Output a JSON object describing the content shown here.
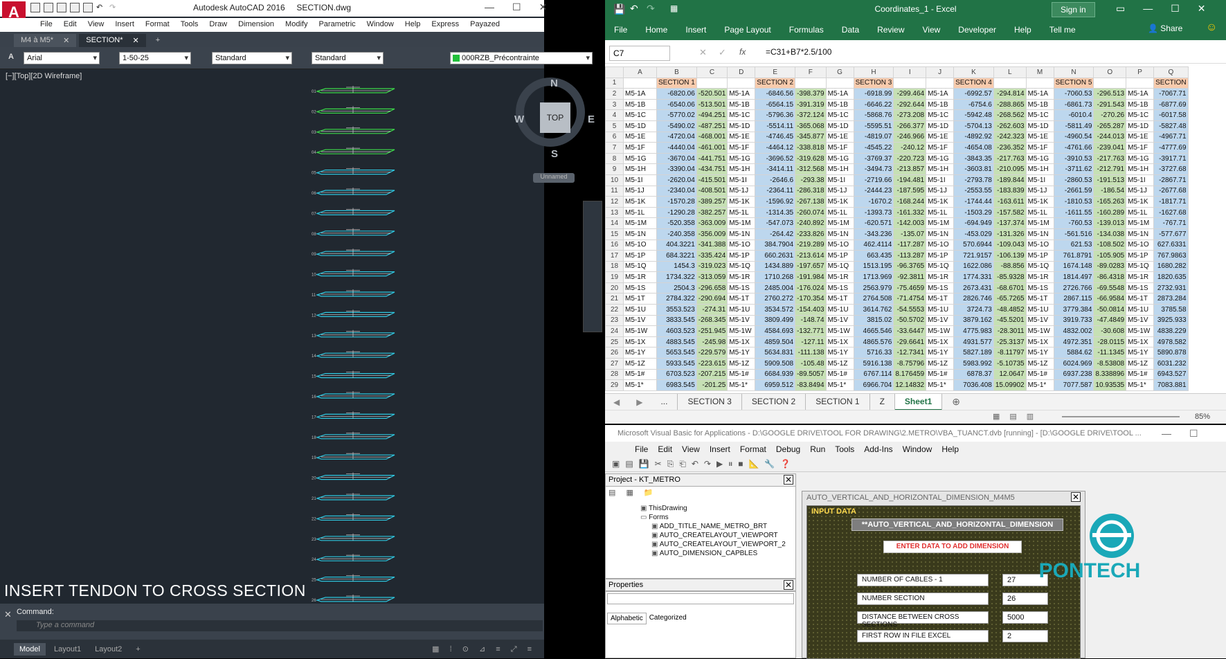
{
  "acad": {
    "app_title": "Autodesk AutoCAD 2016",
    "file_title": "SECTION.dwg",
    "menu": [
      "File",
      "Edit",
      "View",
      "Insert",
      "Format",
      "Tools",
      "Draw",
      "Dimension",
      "Modify",
      "Parametric",
      "Window",
      "Help",
      "Express",
      "Payazed"
    ],
    "tabs": [
      {
        "label": "M4 à M5*"
      },
      {
        "label": "SECTION*"
      }
    ],
    "tab_add": "+",
    "props": {
      "font": "Arial",
      "scale": "1-50-25",
      "text_style": "Standard",
      "dim_style": "Standard",
      "layer": "000RZB_Précontrainte"
    },
    "viewport_label": "[−][Top][2D Wireframe]",
    "viewcube": {
      "top": "TOP",
      "n": "N",
      "s": "S",
      "e": "E",
      "w": "W",
      "unnamed": "Unnamed"
    },
    "caption": "INSERT TENDON TO CROSS SECTION",
    "command_label": "Command:",
    "command_placeholder": "Type a command",
    "layout_tabs": [
      "Model",
      "Layout1",
      "Layout2"
    ],
    "section_numbers": [
      "01",
      "02",
      "03",
      "04",
      "05",
      "06",
      "07",
      "08",
      "09",
      "10",
      "11",
      "12",
      "13",
      "14",
      "15",
      "16",
      "17",
      "18",
      "19",
      "20",
      "21",
      "22",
      "23",
      "24",
      "25",
      "26"
    ],
    "colors": {
      "bg": "#212830",
      "drawing": "#2ec7e0",
      "highlight": "#3ddc4a"
    }
  },
  "excel": {
    "title": "Coordinates_1 - Excel",
    "sign_in": "Sign in",
    "ribbon": [
      "File",
      "Home",
      "Insert",
      "Page Layout",
      "Formulas",
      "Data",
      "Review",
      "View",
      "Developer",
      "Help",
      "Tell me"
    ],
    "share": "Share",
    "name_box": "C7",
    "formula": "=C31+B7*2.5/100",
    "columns": [
      "A",
      "B",
      "C",
      "D",
      "E",
      "F",
      "G",
      "H",
      "I",
      "J",
      "K",
      "L",
      "M",
      "N",
      "O",
      "P",
      "Q"
    ],
    "section_headers": [
      {
        "col": 1,
        "label": "SECTION 1"
      },
      {
        "col": 4,
        "label": "SECTION 2"
      },
      {
        "col": 7,
        "label": "SECTION 3"
      },
      {
        "col": 10,
        "label": "SECTION 4"
      },
      {
        "col": 13,
        "label": "SECTION 5"
      },
      {
        "col": 16,
        "label": "SECTION"
      }
    ],
    "rows": [
      [
        "M5-1A",
        "-6820.06",
        "-520.501",
        "M5-1A",
        "-6846.56",
        "-398.379",
        "M5-1A",
        "-6918.99",
        "-299.464",
        "M5-1A",
        "-6992.57",
        "-294.814",
        "M5-1A",
        "-7060.53",
        "-296.513",
        "M5-1A",
        "-7067.71"
      ],
      [
        "M5-1B",
        "-6540.06",
        "-513.501",
        "M5-1B",
        "-6564.15",
        "-391.319",
        "M5-1B",
        "-6646.22",
        "-292.644",
        "M5-1B",
        "-6754.6",
        "-288.865",
        "M5-1B",
        "-6861.73",
        "-291.543",
        "M5-1B",
        "-6877.69"
      ],
      [
        "M5-1C",
        "-5770.02",
        "-494.251",
        "M5-1C",
        "-5796.36",
        "-372.124",
        "M5-1C",
        "-5868.76",
        "-273.208",
        "M5-1C",
        "-5942.48",
        "-268.562",
        "M5-1C",
        "-6010.4",
        "-270.26",
        "M5-1C",
        "-6017.58"
      ],
      [
        "M5-1D",
        "-5490.02",
        "-487.251",
        "M5-1D",
        "-5514.11",
        "-365.068",
        "M5-1D",
        "-5595.51",
        "-266.377",
        "M5-1D",
        "-5704.13",
        "-262.603",
        "M5-1D",
        "-5811.49",
        "-265.287",
        "M5-1D",
        "-5827.48"
      ],
      [
        "M5-1E",
        "-4720.04",
        "-468.001",
        "M5-1E",
        "-4746.45",
        "-345.877",
        "M5-1E",
        "-4819.07",
        "-246.966",
        "M5-1E",
        "-4892.92",
        "-242.323",
        "M5-1E",
        "-4960.54",
        "-244.013",
        "M5-1E",
        "-4967.71"
      ],
      [
        "M5-1F",
        "-4440.04",
        "-461.001",
        "M5-1F",
        "-4464.12",
        "-338.818",
        "M5-1F",
        "-4545.22",
        "-240.12",
        "M5-1F",
        "-4654.08",
        "-236.352",
        "M5-1F",
        "-4761.66",
        "-239.041",
        "M5-1F",
        "-4777.69"
      ],
      [
        "M5-1G",
        "-3670.04",
        "-441.751",
        "M5-1G",
        "-3696.52",
        "-319.628",
        "M5-1G",
        "-3769.37",
        "-220.723",
        "M5-1G",
        "-3843.35",
        "-217.763",
        "M5-1G",
        "-3910.53",
        "-217.763",
        "M5-1G",
        "-3917.71"
      ],
      [
        "M5-1H",
        "-3390.04",
        "-434.751",
        "M5-1H",
        "-3414.11",
        "-312.568",
        "M5-1H",
        "-3494.73",
        "-213.857",
        "M5-1H",
        "-3603.81",
        "-210.095",
        "M5-1H",
        "-3711.62",
        "-212.791",
        "M5-1H",
        "-3727.68"
      ],
      [
        "M5-1I",
        "-2620.04",
        "-415.501",
        "M5-1I",
        "-2646.6",
        "-293.38",
        "M5-1I",
        "-2719.66",
        "-194.481",
        "M5-1I",
        "-2793.78",
        "-189.844",
        "M5-1I",
        "-2860.53",
        "-191.513",
        "M5-1I",
        "-2867.71"
      ],
      [
        "M5-1J",
        "-2340.04",
        "-408.501",
        "M5-1J",
        "-2364.11",
        "-286.318",
        "M5-1J",
        "-2444.23",
        "-187.595",
        "M5-1J",
        "-2553.55",
        "-183.839",
        "M5-1J",
        "-2661.59",
        "-186.54",
        "M5-1J",
        "-2677.68"
      ],
      [
        "M5-1K",
        "-1570.28",
        "-389.257",
        "M5-1K",
        "-1596.92",
        "-267.138",
        "M5-1K",
        "-1670.2",
        "-168.244",
        "M5-1K",
        "-1744.44",
        "-163.611",
        "M5-1K",
        "-1810.53",
        "-165.263",
        "M5-1K",
        "-1817.71"
      ],
      [
        "M5-1L",
        "-1290.28",
        "-382.257",
        "M5-1L",
        "-1314.35",
        "-260.074",
        "M5-1L",
        "-1393.73",
        "-161.332",
        "M5-1L",
        "-1503.29",
        "-157.582",
        "M5-1L",
        "-1611.55",
        "-160.289",
        "M5-1L",
        "-1627.68"
      ],
      [
        "M5-1M",
        "-520.358",
        "-363.009",
        "M5-1M",
        "-547.073",
        "-240.892",
        "M5-1M",
        "-620.571",
        "-142.003",
        "M5-1M",
        "-694.949",
        "-137.374",
        "M5-1M",
        "-760.53",
        "-139.013",
        "M5-1M",
        "-767.71"
      ],
      [
        "M5-1N",
        "-240.358",
        "-356.009",
        "M5-1N",
        "-264.42",
        "-233.826",
        "M5-1N",
        "-343.236",
        "-135.07",
        "M5-1N",
        "-453.029",
        "-131.326",
        "M5-1N",
        "-561.516",
        "-134.038",
        "M5-1N",
        "-577.677"
      ],
      [
        "M5-1O",
        "404.3221",
        "-341.388",
        "M5-1O",
        "384.7904",
        "-219.289",
        "M5-1O",
        "462.4114",
        "-117.287",
        "M5-1O",
        "570.6944",
        "-109.043",
        "M5-1O",
        "621.53",
        "-108.502",
        "M5-1O",
        "627.6331"
      ],
      [
        "M5-1P",
        "684.3221",
        "-335.424",
        "M5-1P",
        "660.2631",
        "-213.614",
        "M5-1P",
        "663.435",
        "-113.287",
        "M5-1P",
        "721.9157",
        "-106.139",
        "M5-1P",
        "761.8791",
        "-105.905",
        "M5-1P",
        "767.9863"
      ],
      [
        "M5-1Q",
        "1454.3",
        "-319.023",
        "M5-1Q",
        "1434.889",
        "-197.657",
        "M5-1Q",
        "1513.195",
        "-96.3765",
        "M5-1Q",
        "1622.086",
        "-88.856",
        "M5-1Q",
        "1674.148",
        "-89.0283",
        "M5-1Q",
        "1680.282"
      ],
      [
        "M5-1R",
        "1734.322",
        "-313.059",
        "M5-1R",
        "1710.268",
        "-191.984",
        "M5-1R",
        "1713.969",
        "-92.3811",
        "M5-1R",
        "1774.331",
        "-85.9328",
        "M5-1R",
        "1814.497",
        "-86.4318",
        "M5-1R",
        "1820.635"
      ],
      [
        "M5-1S",
        "2504.3",
        "-296.658",
        "M5-1S",
        "2485.004",
        "-176.024",
        "M5-1S",
        "2563.979",
        "-75.4659",
        "M5-1S",
        "2673.431",
        "-68.6701",
        "M5-1S",
        "2726.766",
        "-69.5548",
        "M5-1S",
        "2732.931"
      ],
      [
        "M5-1T",
        "2784.322",
        "-290.694",
        "M5-1T",
        "2760.272",
        "-170.354",
        "M5-1T",
        "2764.508",
        "-71.4754",
        "M5-1T",
        "2826.746",
        "-65.7265",
        "M5-1T",
        "2867.115",
        "-66.9584",
        "M5-1T",
        "2873.284"
      ],
      [
        "M5-1U",
        "3553.523",
        "-274.31",
        "M5-1U",
        "3534.572",
        "-154.403",
        "M5-1U",
        "3614.762",
        "-54.5553",
        "M5-1U",
        "3724.73",
        "-48.4852",
        "M5-1U",
        "3779.384",
        "-50.0814",
        "M5-1U",
        "3785.58"
      ],
      [
        "M5-1V",
        "3833.545",
        "-268.345",
        "M5-1V",
        "3809.499",
        "-148.74",
        "M5-1V",
        "3815.02",
        "-50.5702",
        "M5-1V",
        "3879.162",
        "-45.5201",
        "M5-1V",
        "3919.733",
        "-47.4849",
        "M5-1V",
        "3925.933"
      ],
      [
        "M5-1W",
        "4603.523",
        "-251.945",
        "M5-1W",
        "4584.693",
        "-132.771",
        "M5-1W",
        "4665.546",
        "-33.6447",
        "M5-1W",
        "4775.983",
        "-28.3011",
        "M5-1W",
        "4832.002",
        "-30.608",
        "M5-1W",
        "4838.229"
      ],
      [
        "M5-1X",
        "4883.545",
        "-245.98",
        "M5-1X",
        "4859.504",
        "-127.11",
        "M5-1X",
        "4865.576",
        "-29.6641",
        "M5-1X",
        "4931.577",
        "-25.3137",
        "M5-1X",
        "4972.351",
        "-28.0115",
        "M5-1X",
        "4978.582"
      ],
      [
        "M5-1Y",
        "5653.545",
        "-229.579",
        "M5-1Y",
        "5634.831",
        "-111.138",
        "M5-1Y",
        "5716.33",
        "-12.7341",
        "M5-1Y",
        "5827.189",
        "-8.11797",
        "M5-1Y",
        "5884.62",
        "-11.1345",
        "M5-1Y",
        "5890.878"
      ],
      [
        "M5-1Z",
        "5933.545",
        "-223.615",
        "M5-1Z",
        "5909.508",
        "-105.48",
        "M5-1Z",
        "5916.138",
        "-8.75796",
        "M5-1Z",
        "5983.992",
        "-5.10735",
        "M5-1Z",
        "6024.969",
        "-8.53808",
        "M5-1Z",
        "6031.232"
      ],
      [
        "M5-1#",
        "6703.523",
        "-207.215",
        "M5-1#",
        "6684.939",
        "-89.5057",
        "M5-1#",
        "6767.114",
        "8.176459",
        "M5-1#",
        "6878.37",
        "12.0647",
        "M5-1#",
        "6937.238",
        "8.338896",
        "M5-1#",
        "6943.527"
      ],
      [
        "M5-1*",
        "6983.545",
        "-201.25",
        "M5-1*",
        "6959.512",
        "-83.8494",
        "M5-1*",
        "6966.704",
        "12.14832",
        "M5-1*",
        "7036.408",
        "15.09902",
        "M5-1*",
        "7077.587",
        "10.93535",
        "M5-1*",
        "7083.881"
      ]
    ],
    "sheet_tabs": [
      "...",
      "SECTION 3",
      "SECTION 2",
      "SECTION 1",
      "Z",
      "Sheet1"
    ],
    "active_sheet": "Sheet1",
    "zoom": "85%"
  },
  "vba": {
    "title": "Microsoft Visual Basic for Applications - D:\\GOOGLE DRIVE\\TOOL FOR DRAWING\\2.METRO\\VBA_TUANCT.dvb [running] - [D:\\GOOGLE DRIVE\\TOOL ...",
    "menu": [
      "File",
      "Edit",
      "View",
      "Insert",
      "Format",
      "Debug",
      "Run",
      "Tools",
      "Add-Ins",
      "Window",
      "Help"
    ],
    "project_title": "Project - KT_METRO",
    "tree": [
      "ThisDrawing",
      "Forms",
      "ADD_TITLE_NAME_METRO_BRT",
      "AUTO_CREATELAYOUT_VIEWPORT",
      "AUTO_CREATELAYOUT_VIEWPORT_2",
      "AUTO_DIMENSION_CAPBLES"
    ],
    "properties_title": "Properties",
    "props_tabs": [
      "Alphabetic",
      "Categorized"
    ],
    "form_title": "AUTO_VERTICAL_AND_HORIZONTAL_DIMENSION_M4M5",
    "frame_label": "INPUT DATA",
    "banner": "**AUTO_VERTICAL_AND_HORIZONTAL_DIMENSION",
    "enter_button": "ENTER  DATA TO ADD DIMENSION",
    "fields": [
      {
        "label": "NUMBER OF CABLES - 1",
        "value": "27"
      },
      {
        "label": "NUMBER SECTION",
        "value": "26"
      },
      {
        "label": "DISTANCE BETWEEN CROSS SECTIONS",
        "value": "5000"
      },
      {
        "label": "FIRST ROW IN FILE EXCEL",
        "value": "2"
      }
    ],
    "logo_text": "PONTECH"
  }
}
